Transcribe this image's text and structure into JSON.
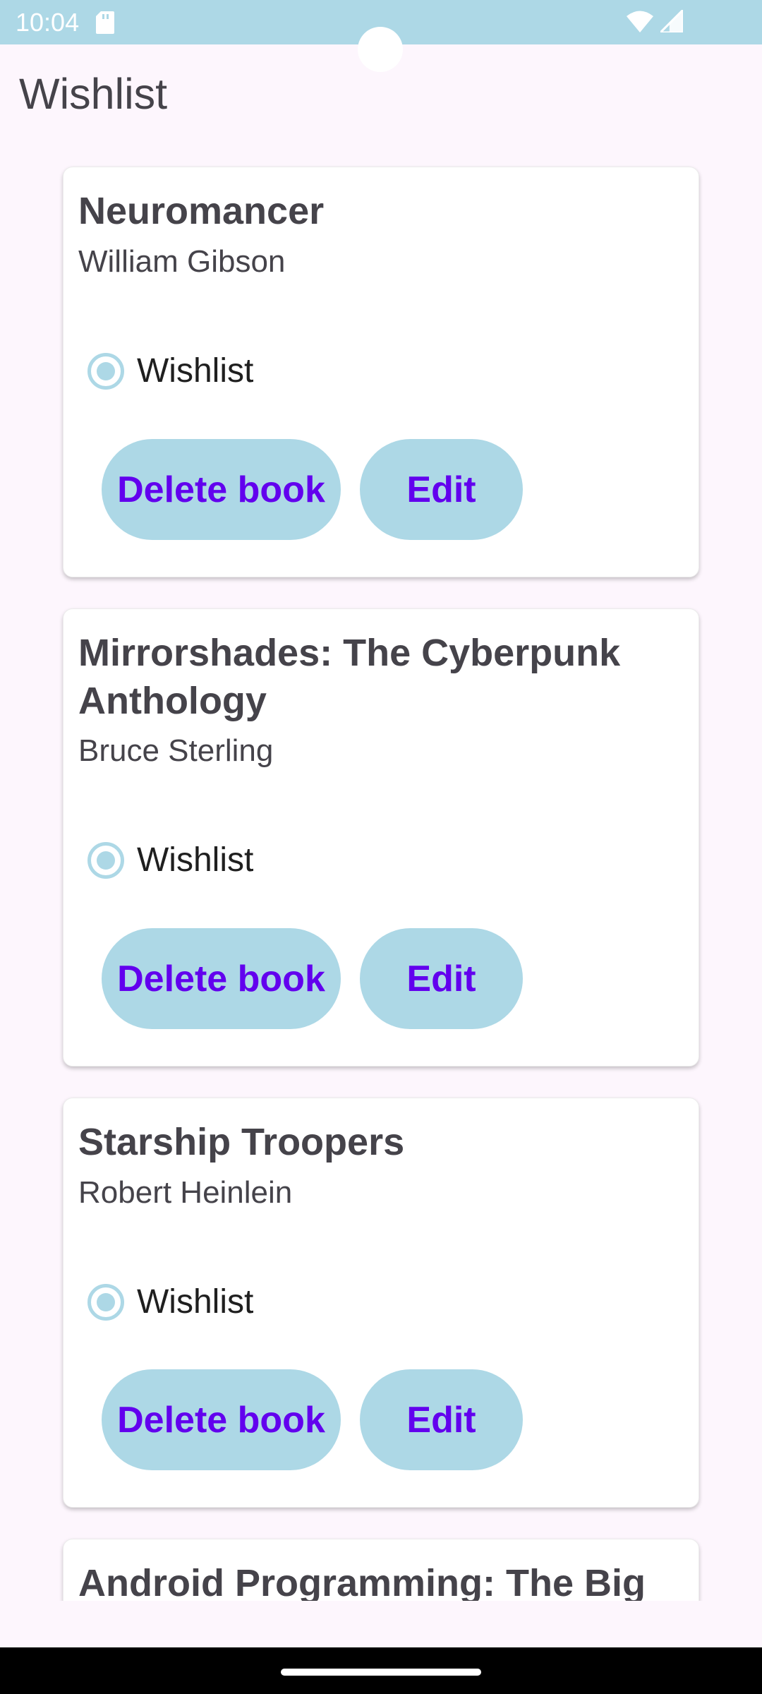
{
  "status_bar": {
    "time": "10:04",
    "icons": [
      "sd-card-icon",
      "wifi-icon",
      "cell-signal-icon"
    ],
    "background": "#add8e6"
  },
  "app_bar": {
    "title": "Wishlist"
  },
  "colors": {
    "accent": "#add8e6",
    "button_text": "#6200ee",
    "title_text": "#45434a",
    "background": "#fdf6fd"
  },
  "books": [
    {
      "title": "Neuromancer",
      "author": "William Gibson",
      "status_label": "Wishlist",
      "status_selected": true,
      "delete_label": "Delete book",
      "edit_label": "Edit"
    },
    {
      "title": "Mirrorshades: The Cyberpunk Anthology",
      "author": "Bruce Sterling",
      "status_label": "Wishlist",
      "status_selected": true,
      "delete_label": "Delete book",
      "edit_label": "Edit"
    },
    {
      "title": "Starship Troopers",
      "author": "Robert Heinlein",
      "status_label": "Wishlist",
      "status_selected": true,
      "delete_label": "Delete book",
      "edit_label": "Edit"
    },
    {
      "title": "Android Programming: The Big"
    }
  ]
}
